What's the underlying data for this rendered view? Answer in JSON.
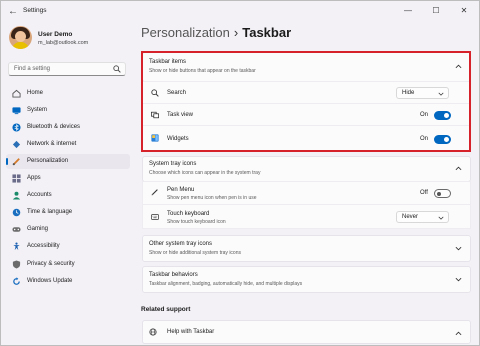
{
  "window": {
    "title": "Settings",
    "controls": {
      "minimize": "—",
      "maximize": "☐",
      "close": "✕"
    }
  },
  "user": {
    "name": "User Demo",
    "email": "m_lab@outlook.com"
  },
  "sidebar": {
    "search_placeholder": "Find a setting",
    "items": [
      {
        "label": "Home",
        "icon": "home-icon",
        "color": "#555555"
      },
      {
        "label": "System",
        "icon": "system-icon",
        "color": "#0067c0"
      },
      {
        "label": "Bluetooth & devices",
        "icon": "bluetooth-icon",
        "color": "#0067c0"
      },
      {
        "label": "Network & internet",
        "icon": "network-icon",
        "color": "#2b6fb6"
      },
      {
        "label": "Personalization",
        "icon": "brush-icon",
        "color": "#d47b2a",
        "active": true
      },
      {
        "label": "Apps",
        "icon": "apps-icon",
        "color": "#6b6b8a"
      },
      {
        "label": "Accounts",
        "icon": "accounts-icon",
        "color": "#1a8a6a"
      },
      {
        "label": "Time & language",
        "icon": "time-icon",
        "color": "#1a6fc0"
      },
      {
        "label": "Gaming",
        "icon": "gaming-icon",
        "color": "#6b6b6b"
      },
      {
        "label": "Accessibility",
        "icon": "accessibility-icon",
        "color": "#1a5fb0"
      },
      {
        "label": "Privacy & security",
        "icon": "shield-icon",
        "color": "#6b6b6b"
      },
      {
        "label": "Windows Update",
        "icon": "update-icon",
        "color": "#1a6fc0"
      }
    ]
  },
  "breadcrumb": {
    "parent": "Personalization",
    "separator": "›",
    "current": "Taskbar"
  },
  "taskbar_items": {
    "title": "Taskbar items",
    "desc": "Show or hide buttons that appear on the taskbar",
    "rows": {
      "search": {
        "label": "Search",
        "value": "Hide"
      },
      "task_view": {
        "label": "Task view",
        "state": "On",
        "on": true
      },
      "widgets": {
        "label": "Widgets",
        "state": "On",
        "on": true
      }
    }
  },
  "system_tray": {
    "title": "System tray icons",
    "desc": "Choose which icons can appear in the system tray",
    "rows": {
      "pen_menu": {
        "label": "Pen Menu",
        "desc": "Show pen menu icon when pen is in use",
        "state": "Off",
        "on": false
      },
      "touch_keyboard": {
        "label": "Touch keyboard",
        "desc": "Show touch keyboard icon",
        "value": "Never"
      }
    }
  },
  "other_tray": {
    "title": "Other system tray icons",
    "desc": "Show or hide additional system tray icons"
  },
  "behaviors": {
    "title": "Taskbar behaviors",
    "desc": "Taskbar alignment, badging, automatically hide, and multiple displays"
  },
  "related": {
    "heading": "Related support",
    "help_label": "Help with Taskbar"
  },
  "colors": {
    "accent": "#0067c0",
    "highlight": "#d6202a"
  }
}
